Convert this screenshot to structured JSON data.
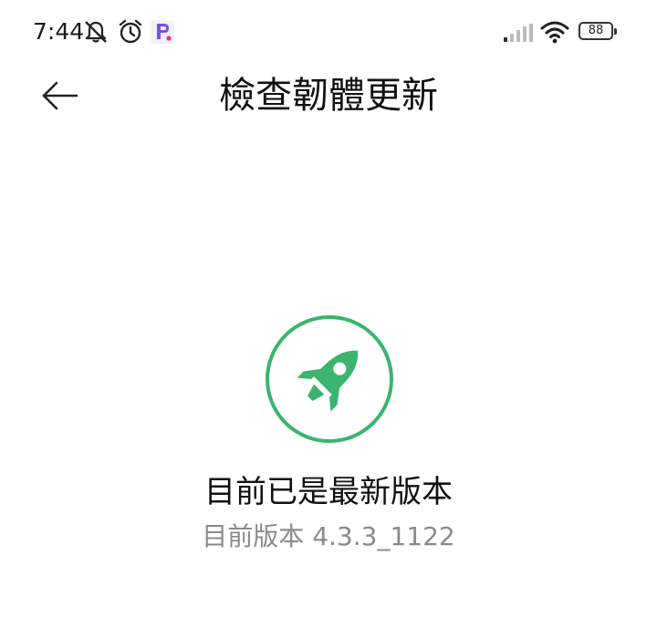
{
  "status_bar": {
    "time": "7:44",
    "battery_level": "88",
    "icons": [
      "mute-bell-icon",
      "alarm-icon",
      "app-notification-icon",
      "signal-icon",
      "wifi-icon",
      "battery-icon"
    ]
  },
  "header": {
    "title": "檢查韌體更新",
    "back_icon": "arrow-left-icon"
  },
  "main": {
    "badge_icon": "rocket-icon",
    "accent_color": "#3ab46e",
    "message": "目前已是最新版本",
    "version_label": "目前版本",
    "version_value": "4.3.3_1122"
  }
}
